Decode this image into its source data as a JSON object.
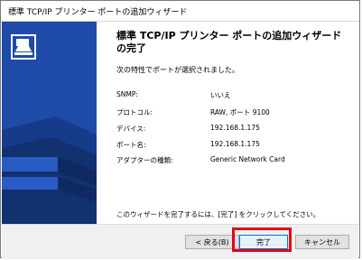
{
  "window": {
    "title": "標準 TCP/IP プリンター ポートの追加ウィザード"
  },
  "main": {
    "heading": "標準 TCP/IP プリンター ポートの追加ウィザードの完了",
    "subtitle": "次の特性でポートが選択されました。",
    "properties": [
      {
        "label": "SNMP:",
        "value": "いいえ"
      },
      {
        "label": "プロトコル:",
        "value": "RAW, ポート 9100"
      },
      {
        "label": "デバイス:",
        "value": "192.168.1.175"
      },
      {
        "label": "ポート名:",
        "value": "192.168.1.175"
      },
      {
        "label": "アダプターの種類:",
        "value": "Generic Network Card"
      }
    ],
    "footer_message": "このウィザードを完了するには、[完了] をクリックしてください。"
  },
  "buttons": {
    "back": "< 戻る(B)",
    "finish": "完了",
    "cancel": "キャンセル"
  },
  "colors": {
    "sidebar": "#1f4ba8",
    "highlight": "#e50012"
  }
}
